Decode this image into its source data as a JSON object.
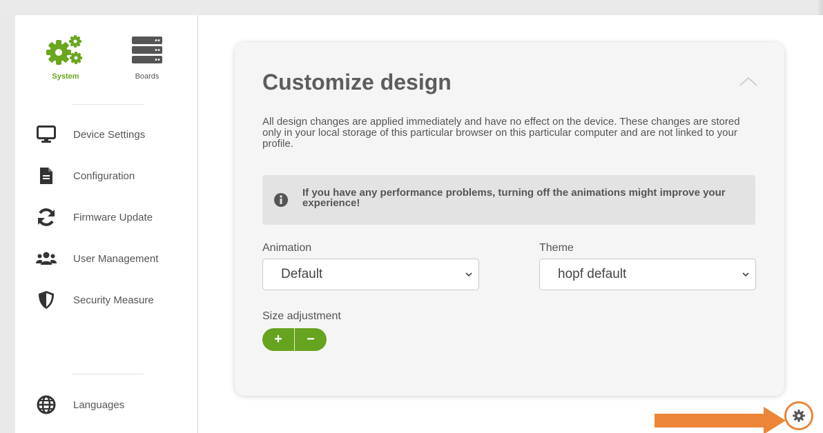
{
  "sidebar": {
    "top": [
      {
        "label": "System",
        "icon": "gears-icon"
      },
      {
        "label": "Boards",
        "icon": "server-icon"
      }
    ],
    "items": [
      {
        "label": "Device Settings",
        "icon": "monitor-icon"
      },
      {
        "label": "Configuration",
        "icon": "file-icon"
      },
      {
        "label": "Firmware Update",
        "icon": "refresh-icon"
      },
      {
        "label": "User Management",
        "icon": "users-icon"
      },
      {
        "label": "Security Measure",
        "icon": "shield-icon"
      }
    ],
    "bottom": {
      "label": "Languages",
      "icon": "globe-icon"
    }
  },
  "card": {
    "title": "Customize design",
    "description": "All design changes are applied immediately and have no effect on the device. These changes are stored only in your local storage of this particular browser on this particular computer and are not linked to your profile.",
    "info": "If you have any performance problems, turning off the animations might improve your experience!",
    "animation": {
      "label": "Animation",
      "value": "Default"
    },
    "theme": {
      "label": "Theme",
      "value": "hopf default"
    },
    "size": {
      "label": "Size adjustment",
      "plus": "+",
      "minus": "−"
    }
  },
  "colors": {
    "accent": "#66a31f",
    "highlight": "#ec8538",
    "card_bg": "#f5f5f5"
  }
}
